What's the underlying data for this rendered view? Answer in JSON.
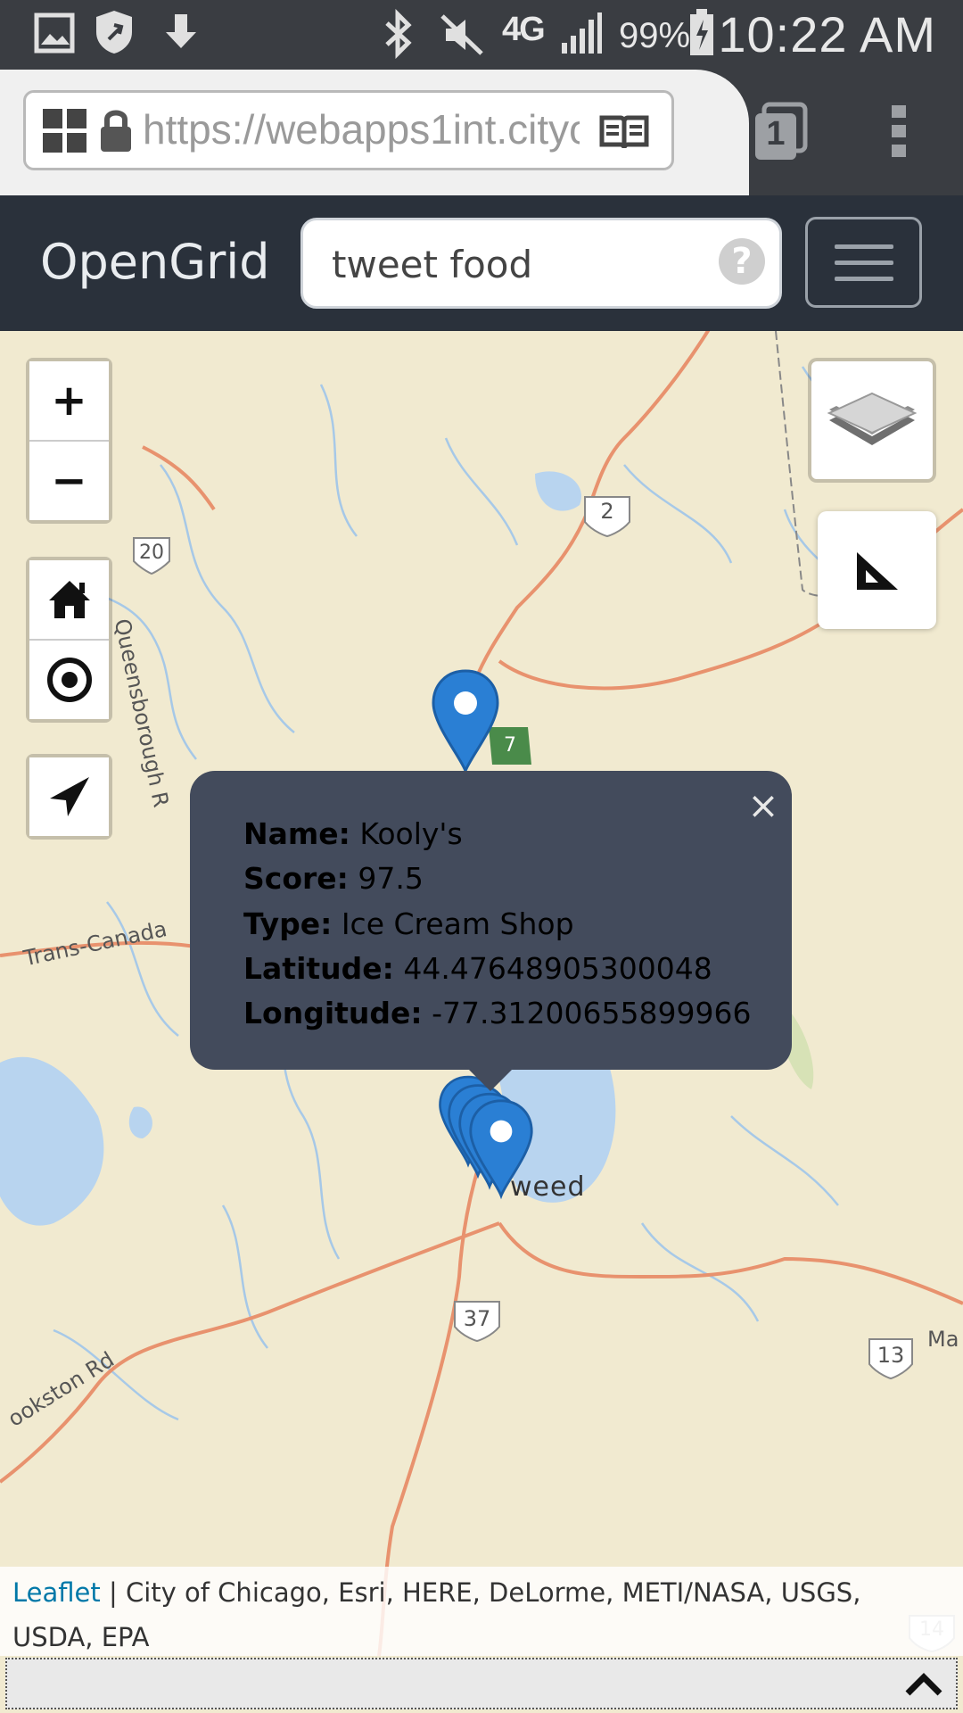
{
  "status_bar": {
    "time": "10:22 AM",
    "battery_percent": "99%",
    "network_type": "4G",
    "icons": [
      "gallery-icon",
      "shield-icon",
      "download-icon",
      "bluetooth-icon",
      "mute-icon",
      "network-type-icon",
      "signal-icon",
      "battery-icon"
    ]
  },
  "browser": {
    "url": "https://webapps1int.cityo",
    "tab_count": "1",
    "icons": [
      "apps-grid-icon",
      "lock-icon",
      "reader-mode-icon",
      "tabs-icon",
      "overflow-menu-icon"
    ]
  },
  "navbar": {
    "brand": "OpenGrid",
    "search_value": "tweet food",
    "help_label": "?"
  },
  "map": {
    "controls": {
      "zoom_in": "+",
      "zoom_out": "−",
      "icons": [
        "home-icon",
        "target-icon",
        "locate-arrow-icon",
        "layers-icon",
        "measure-icon"
      ]
    },
    "labels": {
      "road_20": "20",
      "road_2": "2",
      "road_7": "7",
      "road_37": "37",
      "road_13": "13",
      "road_14": "14",
      "queensborough": "Queensborough R",
      "trans_canada": "Trans-Canada",
      "town": "weed",
      "crookston": "ookston Rd",
      "ma": "Ma"
    },
    "popup": {
      "name_label": "Name:",
      "name_value": "Kooly's",
      "score_label": "Score:",
      "score_value": "97.5",
      "type_label": "Type:",
      "type_value": "Ice Cream Shop",
      "lat_label": "Latitude:",
      "lat_value": "44.47648905300048",
      "lon_label": "Longitude:",
      "lon_value": "-77.31200655899966",
      "close": "×"
    },
    "attribution": {
      "link": "Leaflet",
      "text": " | City of Chicago, Esri, HERE, DeLorme, METI/NASA, USGS, USDA, EPA"
    }
  },
  "drawer": {
    "icons": [
      "chevron-up-icon"
    ]
  },
  "colors": {
    "navbar_bg": "#2a313b",
    "popup_bg": "#434b5c",
    "marker": "#2a7fd4",
    "road": "#e8926e",
    "water": "#b8d4ef"
  }
}
